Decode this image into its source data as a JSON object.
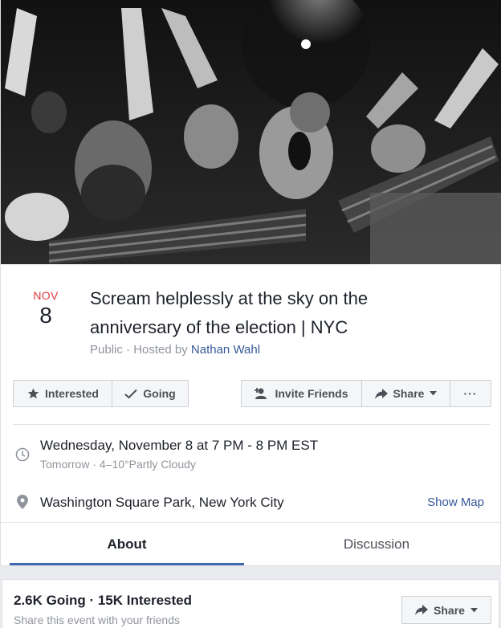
{
  "cover": {
    "alt": "Black and white photo of a crowd screaming and raising arms"
  },
  "event": {
    "month": "NOV",
    "day": "8",
    "title": "Scream helplessly at the sky on the anniversary of the election | NYC",
    "privacy": "Public",
    "hosted_prefix": " · Hosted by ",
    "host": "Nathan Wahl"
  },
  "actions": {
    "interested": "Interested",
    "going": "Going",
    "invite": "Invite Friends",
    "share": "Share",
    "more": "···"
  },
  "details": {
    "datetime": "Wednesday, November 8 at 7 PM - 8 PM EST",
    "weather": "Tomorrow · 4–10°Partly Cloudy",
    "location": "Washington Square Park, New York City",
    "show_map": "Show Map"
  },
  "tabs": [
    {
      "label": "About",
      "active": true
    },
    {
      "label": "Discussion",
      "active": false
    }
  ],
  "summary": {
    "stats": "2.6K Going · 15K Interested",
    "share_prompt": "Share this event with your friends",
    "share": "Share"
  },
  "colors": {
    "accent": "#4267b2",
    "date_month": "#e0393e",
    "link": "#365899",
    "muted": "#90949c"
  },
  "icons": [
    "star-icon",
    "check-icon",
    "add-person-icon",
    "share-arrow-icon",
    "caret-down-icon",
    "clock-icon",
    "location-pin-icon"
  ]
}
